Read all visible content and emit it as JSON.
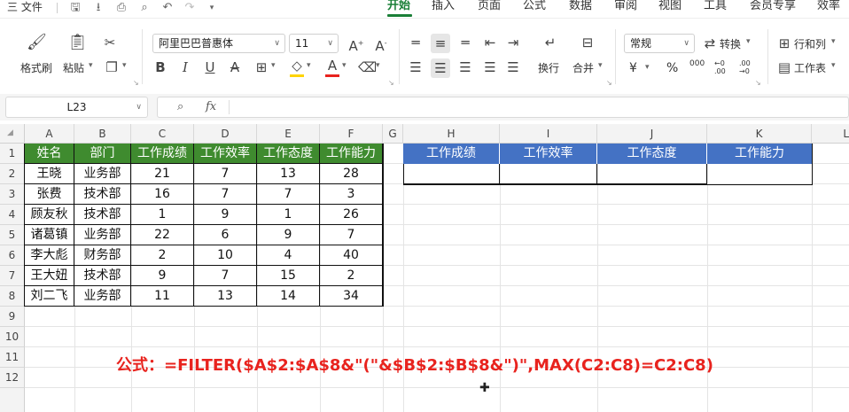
{
  "menubar": {
    "file_menu": "三 文件",
    "tabs": [
      "开始",
      "插入",
      "页面",
      "公式",
      "数据",
      "审阅",
      "视图",
      "工具",
      "会员专享",
      "效率"
    ],
    "active_tab": "开始"
  },
  "ribbon": {
    "format_painter": "格式刷",
    "paste": "粘贴",
    "font_name": "阿里巴巴普惠体",
    "font_size": "11",
    "number_format": "常规",
    "convert": "转换",
    "rows_cols": "行和列",
    "wrap": "换行",
    "merge": "合并",
    "worksheet": "工作表",
    "bold": "B",
    "italic": "I",
    "underline": "U",
    "strike": "A",
    "font_color_letter": "A",
    "currency": "¥",
    "percent": "%",
    "thousands": "000",
    "inc_dec1": "←0 .00",
    "inc_dec2": ".00 →0"
  },
  "formula_bar": {
    "cell_ref": "L23",
    "fx": "fx",
    "content": ""
  },
  "sheet": {
    "columns": [
      "A",
      "B",
      "C",
      "D",
      "E",
      "F",
      "G",
      "H",
      "I",
      "J",
      "K",
      "L"
    ],
    "rows": [
      "1",
      "2",
      "3",
      "4",
      "5",
      "6",
      "7",
      "8",
      "9",
      "10",
      "11",
      "12"
    ],
    "left_table": {
      "headers": [
        "姓名",
        "部门",
        "工作成绩",
        "工作效率",
        "工作态度",
        "工作能力"
      ],
      "rows": [
        [
          "王晓",
          "业务部",
          "21",
          "7",
          "13",
          "28"
        ],
        [
          "张费",
          "技术部",
          "16",
          "7",
          "7",
          "3"
        ],
        [
          "顾友秋",
          "技术部",
          "1",
          "9",
          "1",
          "26"
        ],
        [
          "诸葛镇",
          "业务部",
          "22",
          "6",
          "9",
          "7"
        ],
        [
          "李大彪",
          "财务部",
          "2",
          "10",
          "4",
          "40"
        ],
        [
          "王大妞",
          "技术部",
          "9",
          "7",
          "15",
          "2"
        ],
        [
          "刘二飞",
          "业务部",
          "11",
          "13",
          "14",
          "34"
        ]
      ]
    },
    "right_table": {
      "headers": [
        "工作成绩",
        "工作效率",
        "工作态度",
        "工作能力"
      ]
    },
    "formula_note": "公式：=FILTER($A$2:$A$8&\"(\"&$B$2:$B$8&\")\",MAX(C2:C8)=C2:C8)"
  },
  "colors": {
    "accent_green": "#1a7f37",
    "header_green": "#3f8b2f",
    "header_blue": "#4472c4",
    "note_red": "#e8231e"
  }
}
